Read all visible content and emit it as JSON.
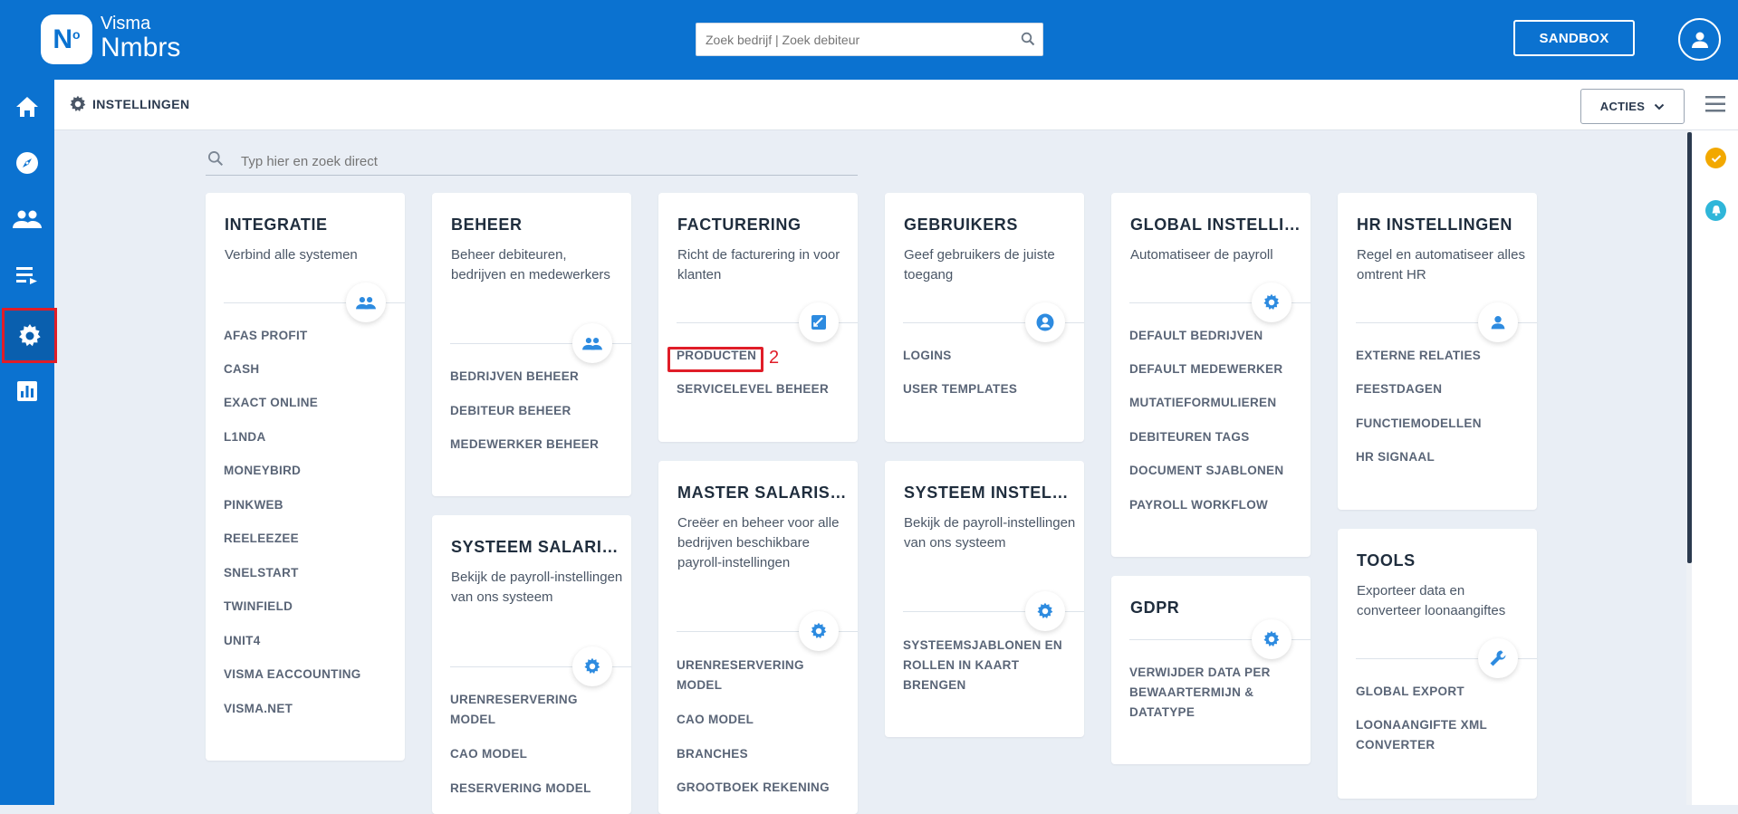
{
  "header": {
    "logo_mark": "N",
    "logo_sup": "o",
    "logo_line1": "Visma",
    "logo_line2": "Nmbrs",
    "search_placeholder": "Zoek bedrijf | Zoek debiteur",
    "sandbox_label": "SANDBOX"
  },
  "sidebar": {
    "items": [
      {
        "name": "home-icon"
      },
      {
        "name": "compass-icon"
      },
      {
        "name": "people-icon"
      },
      {
        "name": "list-icon"
      },
      {
        "name": "gear-icon",
        "selected": true
      },
      {
        "name": "chart-icon"
      }
    ]
  },
  "subheader": {
    "title": "INSTELLINGEN",
    "actions_label": "ACTIES"
  },
  "filter": {
    "placeholder": "Typ hier en zoek direct"
  },
  "cards": {
    "integratie": {
      "title": "INTEGRATIE",
      "desc": "Verbind alle systemen",
      "links": [
        "AFAS PROFIT",
        "CASH",
        "EXACT ONLINE",
        "L1NDA",
        "MONEYBIRD",
        "PINKWEB",
        "REELEEZEE",
        "SNELSTART",
        "TWINFIELD",
        "UNIT4",
        "VISMA EACCOUNTING",
        "VISMA.NET"
      ]
    },
    "beheer": {
      "title": "BEHEER",
      "desc": "Beheer debiteuren, bedrijven en medewerkers",
      "links": [
        "BEDRIJVEN BEHEER",
        "DEBITEUR BEHEER",
        "MEDEWERKER BEHEER"
      ]
    },
    "systeem_salaris": {
      "title": "SYSTEEM SALARISVERWERKING",
      "desc": "Bekijk de payroll-instellingen van ons systeem",
      "links": [
        "URENRESERVERING MODEL",
        "CAO MODEL",
        "RESERVERING MODEL"
      ]
    },
    "facturering": {
      "title": "FACTURERING",
      "desc": "Richt de facturering in voor klanten",
      "links": [
        "PRODUCTEN",
        "SERVICELEVEL BEHEER"
      ]
    },
    "master_salaris": {
      "title": "MASTER SALARISVERWERKING",
      "desc": "Creëer en beheer voor alle bedrijven beschikbare payroll-instellingen",
      "links": [
        "URENRESERVERING MODEL",
        "CAO MODEL",
        "BRANCHES",
        "GROOTBOEK REKENING"
      ]
    },
    "gebruikers": {
      "title": "GEBRUIKERS",
      "desc": "Geef gebruikers de juiste toegang",
      "links": [
        "LOGINS",
        "USER TEMPLATES"
      ]
    },
    "systeem_instellingen": {
      "title": "SYSTEEM INSTELLINGEN",
      "desc": "Bekijk de payroll-instellingen van ons systeem",
      "links": [
        "SYSTEEMSJABLONEN EN ROLLEN IN KAART BRENGEN"
      ]
    },
    "global": {
      "title": "GLOBAL INSTELLINGEN",
      "desc": "Automatiseer de payroll",
      "links": [
        "DEFAULT BEDRIJVEN",
        "DEFAULT MEDEWERKER",
        "MUTATIEFORMULIEREN",
        "DEBITEUREN TAGS",
        "DOCUMENT SJABLONEN",
        "PAYROLL WORKFLOW"
      ]
    },
    "gdpr": {
      "title": "GDPR",
      "desc": "",
      "links": [
        "VERWIJDER DATA PER BEWAARTERMIJN & DATATYPE"
      ]
    },
    "hr": {
      "title": "HR INSTELLINGEN",
      "desc": "Regel en automatiseer alles omtrent HR",
      "links": [
        "EXTERNE RELATIES",
        "FEESTDAGEN",
        "FUNCTIEMODELLEN",
        "HR SIGNAAL"
      ]
    },
    "tools": {
      "title": "TOOLS",
      "desc": "Exporteer data en converteer loonaangiftes",
      "links": [
        "GLOBAL EXPORT",
        "LOONAANGIFTE XML CONVERTER"
      ]
    }
  },
  "annotation": {
    "step_number": "2"
  },
  "colors": {
    "brand_blue": "#0b72d0",
    "highlight_red": "#e01d28",
    "accent_orange": "#f2a800",
    "accent_teal": "#2fb6d9"
  }
}
